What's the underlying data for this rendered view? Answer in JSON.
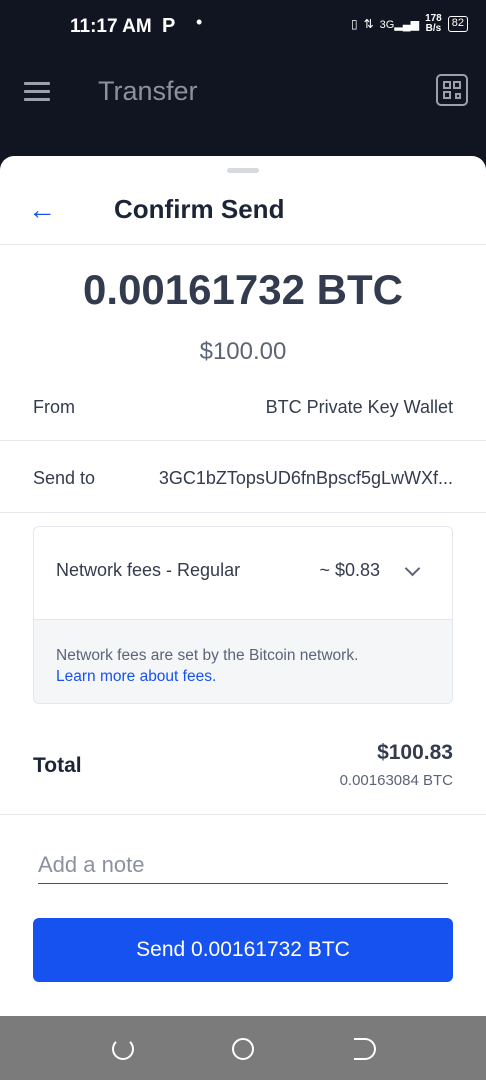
{
  "status_bar": {
    "time": "11:17 AM",
    "carrier_icon": "P",
    "dot": "•",
    "network_type": "3G",
    "speed_value": "178",
    "speed_unit": "B/s",
    "battery": "82"
  },
  "header": {
    "title": "Transfer",
    "menu_icon": "hamburger-menu-icon",
    "qr_icon": "qr-scan-icon"
  },
  "sheet": {
    "back_icon": "arrow-left-icon",
    "back_glyph": "←",
    "title": "Confirm Send",
    "amount_crypto": "0.00161732 BTC",
    "amount_fiat": "$100.00",
    "from_label": "From",
    "from_value": "BTC Private Key Wallet",
    "send_to_label": "Send to",
    "send_to_value": "3GC1bZTopsUD6fnBpscf5gLwWXf...",
    "fees": {
      "label": "Network fees - Regular",
      "amount": "~ $0.83",
      "expand_icon": "chevron-down-icon",
      "info_text": "Network fees are set by the Bitcoin network.",
      "link_text": "Learn more about fees."
    },
    "total": {
      "label": "Total",
      "fiat": "$100.83",
      "crypto": "0.00163084 BTC"
    },
    "note_placeholder": "Add a note",
    "note_value": "",
    "send_button_label": "Send 0.00161732 BTC"
  },
  "colors": {
    "accent": "#1652f0",
    "header_bg": "#111521",
    "text_primary": "#333c4e"
  }
}
